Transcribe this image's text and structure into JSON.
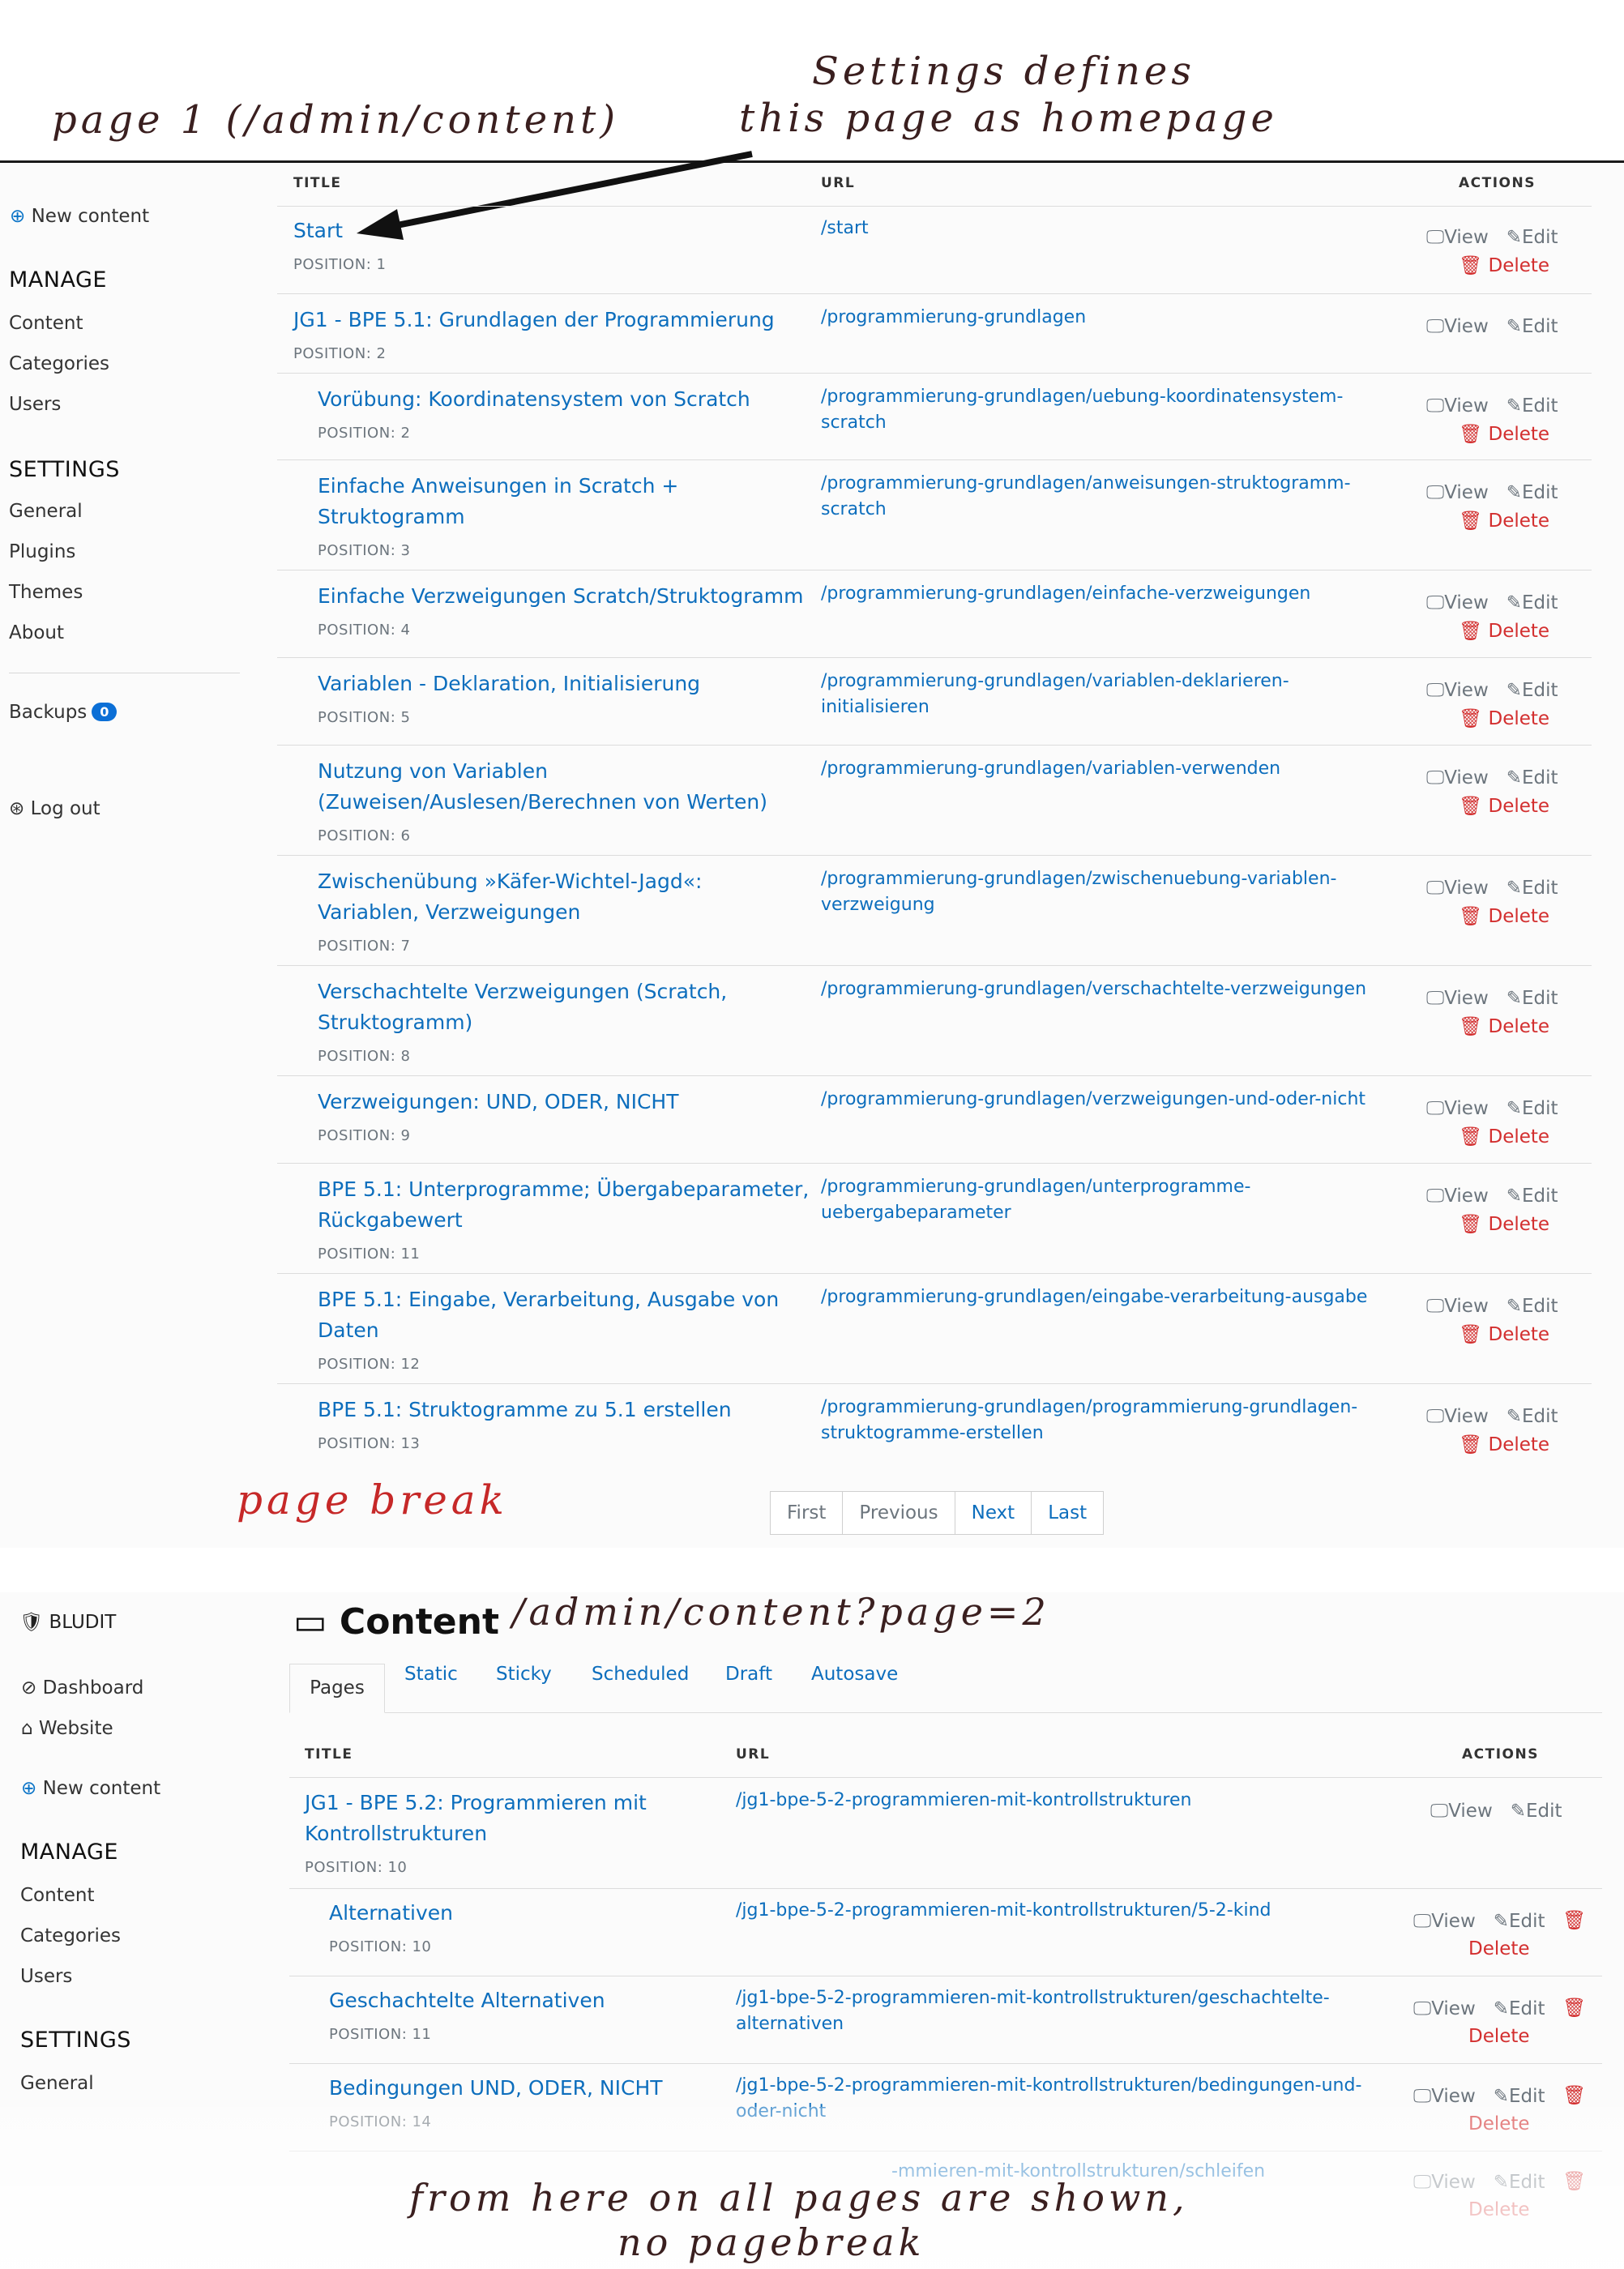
{
  "annotations": {
    "page1_label": "page 1 (/admin/content)",
    "homepage_line1": "Settings defines",
    "homepage_line2": "this page as homepage",
    "page_break": "page break",
    "page2_url": "/admin/content?page=2",
    "footer_line1": "from here on all pages are shown,",
    "footer_line2": "no pagebreak"
  },
  "sidebar1": {
    "new_content": "New content",
    "manage_heading": "MANAGE",
    "manage_items": [
      "Content",
      "Categories",
      "Users"
    ],
    "settings_heading": "SETTINGS",
    "settings_items": [
      "General",
      "Plugins",
      "Themes",
      "About"
    ],
    "backups_label": "Backups",
    "backups_count": "0",
    "logout": "Log out"
  },
  "table_headers": {
    "title": "TITLE",
    "url": "URL",
    "actions": "ACTIONS"
  },
  "actions": {
    "view": "View",
    "edit": "Edit",
    "delete": "Delete"
  },
  "rows1": [
    {
      "title": "Start",
      "position": "POSITION: 1",
      "url": "/start"
    },
    {
      "title": "JG1 - BPE 5.1: Grundlagen der Programmierung",
      "position": "POSITION: 2",
      "url": "/programmierung-grundlagen"
    },
    {
      "title": "Vorübung: Koordinatensystem von Scratch",
      "position": "POSITION: 2",
      "url": "/programmierung-grundlagen/uebung-koordinatensystem-",
      "url2": "scratch"
    },
    {
      "title": "Einfache Anweisungen in Scratch +",
      "title2": "Struktogramm",
      "position": "POSITION: 3",
      "url": "/programmierung-grundlagen/anweisungen-struktogramm-",
      "url2": "scratch"
    },
    {
      "title": "Einfache Verzweigungen Scratch/Struktogramm",
      "position": "POSITION: 4",
      "url": "/programmierung-grundlagen/einfache-verzweigungen"
    },
    {
      "title": "Variablen - Deklaration, Initialisierung",
      "position": "POSITION: 5",
      "url": "/programmierung-grundlagen/variablen-deklarieren-",
      "url2": "initialisieren"
    },
    {
      "title": "Nutzung von Variablen",
      "title2": "(Zuweisen/Auslesen/Berechnen von Werten)",
      "position": "POSITION: 6",
      "url": "/programmierung-grundlagen/variablen-verwenden"
    },
    {
      "title": "Zwischenübung »Käfer-Wichtel-Jagd«:",
      "title2": "Variablen, Verzweigungen",
      "position": "POSITION: 7",
      "url": "/programmierung-grundlagen/zwischenuebung-variablen-",
      "url2": "verzweigung"
    },
    {
      "title": "Verschachtelte Verzweigungen (Scratch,",
      "title2": "Struktogramm)",
      "position": "POSITION: 8",
      "url": "/programmierung-grundlagen/verschachtelte-verzweigungen"
    },
    {
      "title": "Verzweigungen: UND, ODER, NICHT",
      "position": "POSITION: 9",
      "url": "/programmierung-grundlagen/verzweigungen-und-oder-nicht"
    },
    {
      "title": "BPE 5.1: Unterprogramme; Übergabeparameter,",
      "title2": "Rückgabewert",
      "position": "POSITION: 11",
      "url": "/programmierung-grundlagen/unterprogramme-",
      "url2": "uebergabeparameter"
    },
    {
      "title": "BPE 5.1: Eingabe, Verarbeitung, Ausgabe von",
      "title2": "Daten",
      "position": "POSITION: 12",
      "url": "/programmierung-grundlagen/eingabe-verarbeitung-ausgabe"
    },
    {
      "title": "BPE 5.1: Struktogramme zu 5.1 erstellen",
      "position": "POSITION: 13",
      "url": "/programmierung-grundlagen/programmierung-grundlagen-",
      "url2": "struktogramme-erstellen"
    }
  ],
  "pagination": {
    "first": "First",
    "previous": "Previous",
    "next": "Next",
    "last": "Last"
  },
  "sidebar2": {
    "brand": "BLUDIT",
    "dashboard": "Dashboard",
    "website": "Website",
    "new_content": "New content",
    "manage_heading": "MANAGE",
    "manage_items": [
      "Content",
      "Categories",
      "Users"
    ],
    "settings_heading": "SETTINGS",
    "settings_items": [
      "General"
    ]
  },
  "content_title": "Content",
  "tabs": [
    "Pages",
    "Static",
    "Sticky",
    "Scheduled",
    "Draft",
    "Autosave"
  ],
  "rows2": [
    {
      "title": "JG1 - BPE 5.2: Programmieren mit",
      "title2": "Kontrollstrukturen",
      "position": "POSITION: 10",
      "url": "/jg1-bpe-5-2-programmieren-mit-kontrollstrukturen"
    },
    {
      "title": "Alternativen",
      "position": "POSITION: 10",
      "url": "/jg1-bpe-5-2-programmieren-mit-kontrollstrukturen/5-2-kind"
    },
    {
      "title": "Geschachtelte Alternativen",
      "position": "POSITION: 11",
      "url": "/jg1-bpe-5-2-programmieren-mit-kontrollstrukturen/geschachtelte-",
      "url2": "alternativen"
    },
    {
      "title": "Bedingungen UND, ODER, NICHT",
      "position": "POSITION: 14",
      "url": "/jg1-bpe-5-2-programmieren-mit-kontrollstrukturen/bedingungen-und-",
      "url2": "oder-nicht"
    },
    {
      "url": "-mmieren-mit-kontrollstrukturen/schleifen"
    }
  ],
  "colors": {
    "link": "#0d6ebd",
    "delete": "#d32f2f",
    "badge": "#0b6fd6",
    "annotation_red": "#c62828"
  }
}
